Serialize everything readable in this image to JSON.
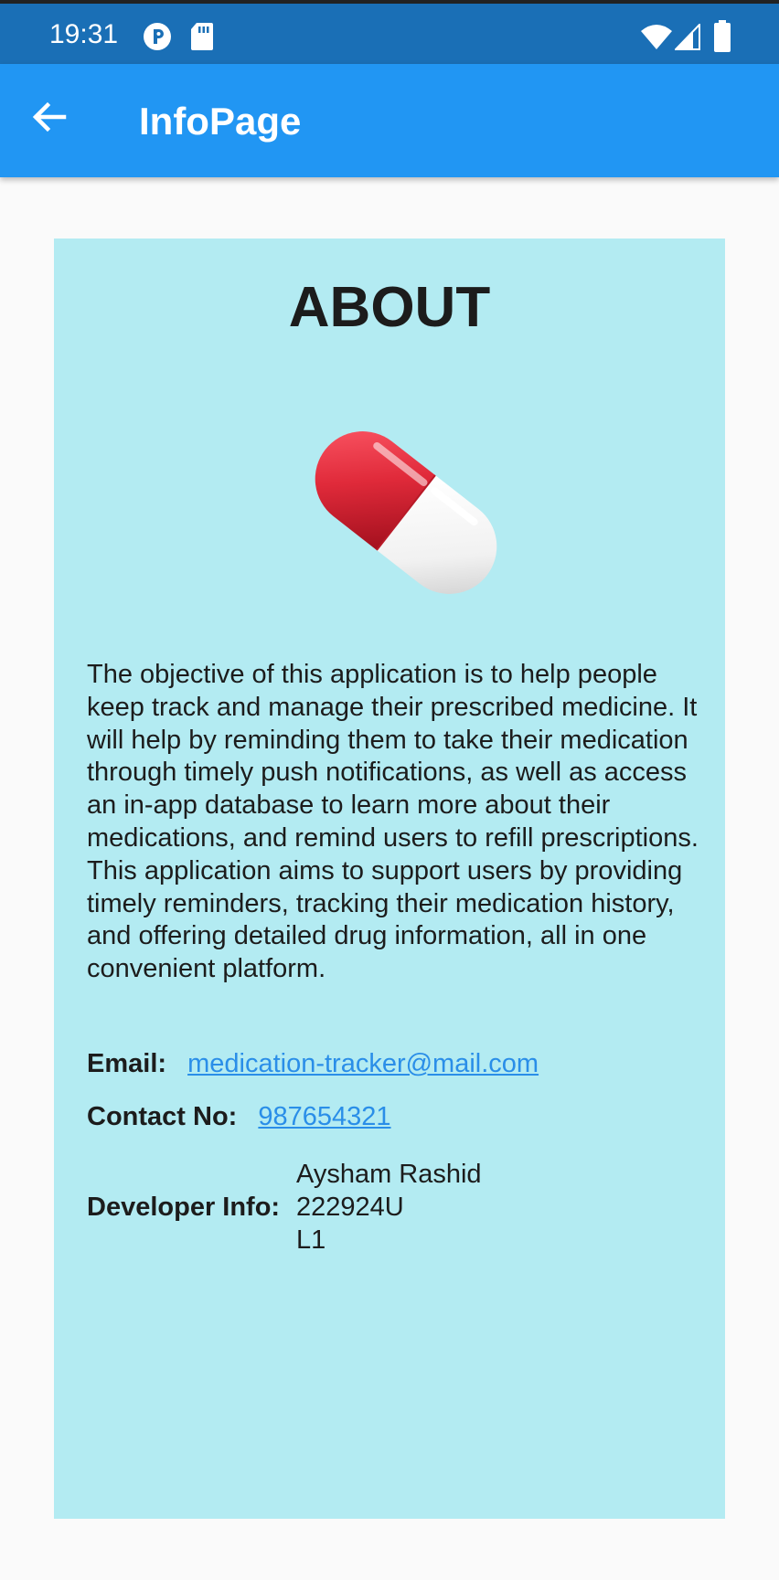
{
  "status_bar": {
    "time": "19:31",
    "left_icons": [
      "podcast-app-icon",
      "sd-card-icon"
    ],
    "right_icons": [
      "wifi-icon",
      "cell-signal-icon",
      "battery-icon"
    ]
  },
  "app_bar": {
    "title": "InfoPage",
    "back_icon": "arrow-left-icon"
  },
  "card": {
    "title": "ABOUT",
    "image": "pill-capsule-icon",
    "description": "The objective of this application is to help people keep track and manage their prescribed medicine. It will help by reminding them to take their medication through timely push notifications, as well as access an in-app database to learn more about their medications, and remind users to refill prescriptions. This application aims to support users by providing timely reminders, tracking their medication history, and offering detailed drug information, all in one convenient platform.",
    "email_label": "Email:",
    "email_value": "medication-tracker@mail.com",
    "contact_label": "Contact No:",
    "contact_value": "987654321",
    "developer_label": "Developer Info:",
    "developer_lines": [
      "Aysham Rashid",
      "222924U",
      "L1"
    ]
  },
  "colors": {
    "status_bar": "#1a6fb6",
    "app_bar": "#2196f3",
    "card_background": "#b3ebf2",
    "page_background": "#fafafa",
    "link": "#2a8ee8"
  }
}
